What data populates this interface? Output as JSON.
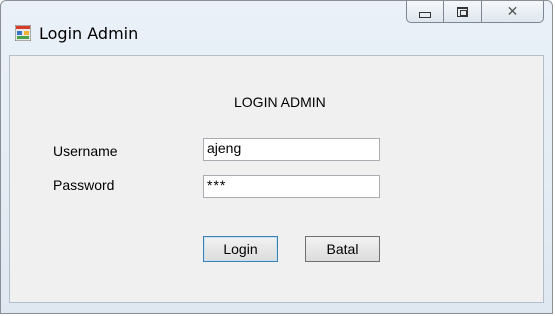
{
  "window": {
    "title": "Login Admin",
    "app_icon": "windows-form-icon",
    "caption_buttons": {
      "minimize": "minimize-icon",
      "maximize": "maximize-icon",
      "close": "close-icon"
    }
  },
  "form": {
    "heading": "LOGIN ADMIN",
    "username_label": "Username",
    "username_value": "ajeng",
    "password_label": "Password",
    "password_value": "***",
    "login_button": "Login",
    "cancel_button": "Batal"
  },
  "colors": {
    "title_bar": "#dfe8f1",
    "client_area": "#f0f0f0",
    "default_button_border": "#3c7fb1"
  }
}
